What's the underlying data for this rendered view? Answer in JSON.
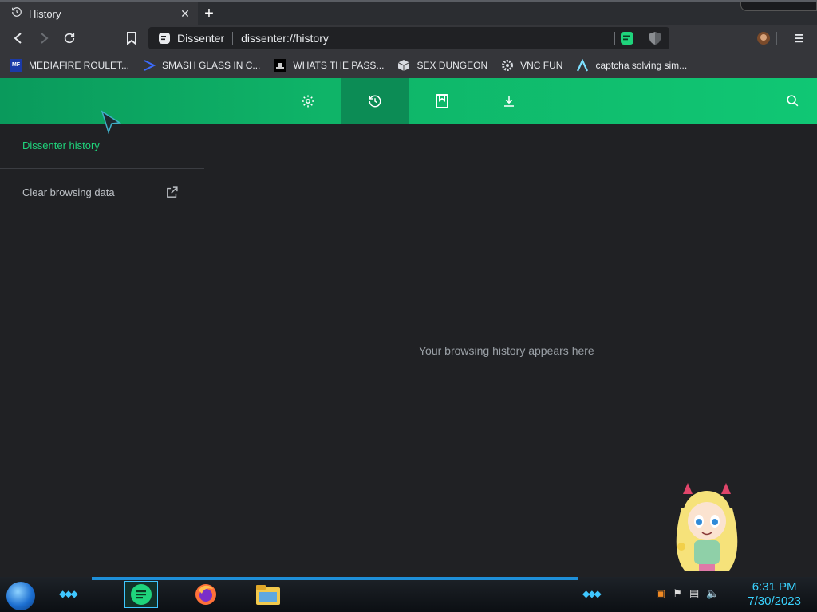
{
  "tab": {
    "title": "History"
  },
  "toolbar": {
    "site_name": "Dissenter",
    "url": "dissenter://history"
  },
  "bookmarks": [
    {
      "label": "MEDIAFIRE ROULET...",
      "icon": "mediafire-icon",
      "fav_text": "MF"
    },
    {
      "label": "SMASH GLASS IN C...",
      "icon": "sigma-icon"
    },
    {
      "label": "WHATS THE PASS...",
      "icon": "hat-icon"
    },
    {
      "label": "SEX DUNGEON",
      "icon": "cube-icon"
    },
    {
      "label": "VNC FUN",
      "icon": "gear-icon"
    },
    {
      "label": "captcha solving sim...",
      "icon": "lambda-icon"
    }
  ],
  "sidebar": {
    "title": "Dissenter history",
    "clear_label": "Clear browsing data"
  },
  "main": {
    "empty_message": "Your browsing history appears here"
  },
  "taskbar": {
    "time": "6:31 PM",
    "date": "7/30/2023"
  },
  "colors": {
    "accent": "#10c774",
    "active_tab": "#0c8c55",
    "background": "#202124"
  }
}
